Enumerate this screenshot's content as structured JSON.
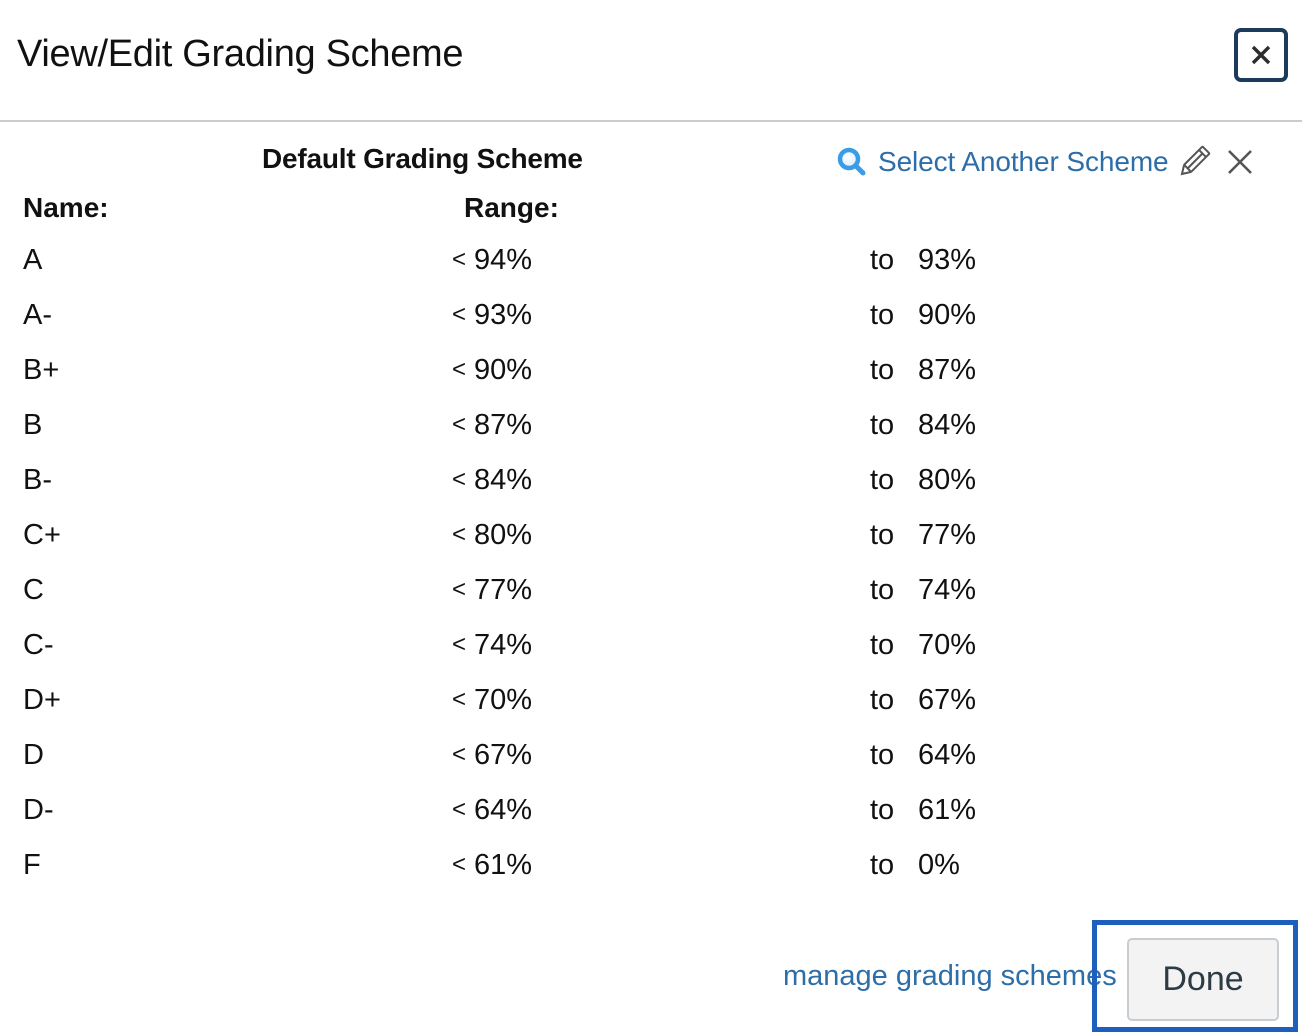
{
  "dialog": {
    "title": "View/Edit Grading Scheme",
    "close_icon": "close-icon"
  },
  "scheme": {
    "title": "Default Grading Scheme",
    "select_another_label": "Select Another Scheme",
    "icons": {
      "search": "search-icon",
      "edit": "pencil-icon",
      "remove": "x-icon"
    },
    "link_color": "#2d6ea8"
  },
  "table": {
    "headers": {
      "name": "Name:",
      "range": "Range:"
    },
    "upper_prefix": "<",
    "to_label": "to",
    "rows": [
      {
        "name": "A",
        "upper": "94%",
        "lower": "93%"
      },
      {
        "name": "A-",
        "upper": "93%",
        "lower": "90%"
      },
      {
        "name": "B+",
        "upper": "90%",
        "lower": "87%"
      },
      {
        "name": "B",
        "upper": "87%",
        "lower": "84%"
      },
      {
        "name": "B-",
        "upper": "84%",
        "lower": "80%"
      },
      {
        "name": "C+",
        "upper": "80%",
        "lower": "77%"
      },
      {
        "name": "C",
        "upper": "77%",
        "lower": "74%"
      },
      {
        "name": "C-",
        "upper": "74%",
        "lower": "70%"
      },
      {
        "name": "D+",
        "upper": "70%",
        "lower": "67%"
      },
      {
        "name": "D",
        "upper": "67%",
        "lower": "64%"
      },
      {
        "name": "D-",
        "upper": "64%",
        "lower": "61%"
      },
      {
        "name": "F",
        "upper": "61%",
        "lower": "0%"
      }
    ]
  },
  "footer": {
    "manage_label": "manage grading schemes",
    "done_label": "Done"
  },
  "colors": {
    "focus_ring": "#1d5fbd",
    "close_border": "#1b3a5c"
  }
}
